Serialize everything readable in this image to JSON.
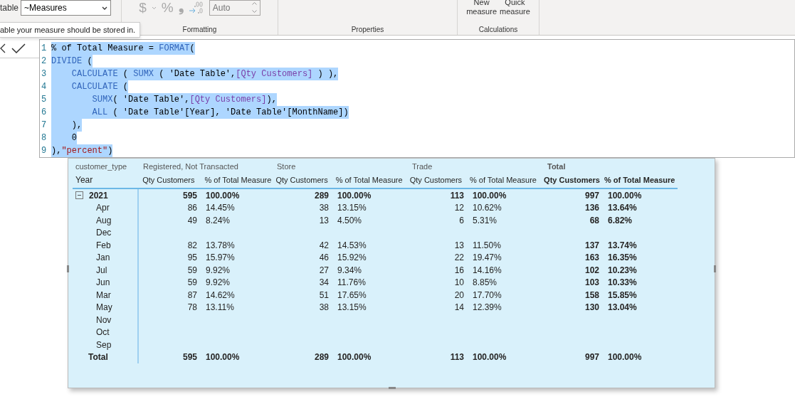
{
  "ribbon": {
    "table_label": "table",
    "table_dropdown": "~Measures",
    "tooltip": "able your measure should be stored in.",
    "currency_symbol": "$",
    "percent_symbol": "%",
    "comma_symbol": "❟",
    "decimal_field": {
      "placeholder": "Auto",
      "disabled": true
    },
    "groups": [
      "Formatting",
      "Properties",
      "Calculations"
    ],
    "buttons": [
      {
        "line1": "New",
        "line2": "measure"
      },
      {
        "line1": "Quick",
        "line2": "measure"
      }
    ]
  },
  "editor": {
    "lines": [
      {
        "number": "1",
        "tokens": [
          {
            "kind": "plain",
            "text": "% of Total Measure = "
          },
          {
            "kind": "fn",
            "text": "FORMAT"
          },
          {
            "kind": "plain",
            "text": "("
          }
        ]
      },
      {
        "number": "2",
        "tokens": [
          {
            "kind": "fn",
            "text": "DIVIDE"
          },
          {
            "kind": "plain",
            "text": " ("
          }
        ]
      },
      {
        "number": "3",
        "tokens": [
          {
            "kind": "fn",
            "text": "    CALCULATE"
          },
          {
            "kind": "plain",
            "text": " ( "
          },
          {
            "kind": "fn",
            "text": "SUMX"
          },
          {
            "kind": "plain",
            "text": " ( 'Date Table',"
          },
          {
            "kind": "measure",
            "text": "[Qty Customers]"
          },
          {
            "kind": "plain",
            "text": " ) ),"
          }
        ]
      },
      {
        "number": "4",
        "tokens": [
          {
            "kind": "fn",
            "text": "    CALCULATE"
          },
          {
            "kind": "plain",
            "text": " ("
          }
        ]
      },
      {
        "number": "5",
        "tokens": [
          {
            "kind": "fn",
            "text": "        SUMX"
          },
          {
            "kind": "plain",
            "text": "( 'Date Table',"
          },
          {
            "kind": "measure",
            "text": "[Qty Customers]"
          },
          {
            "kind": "plain",
            "text": "),"
          }
        ]
      },
      {
        "number": "6",
        "tokens": [
          {
            "kind": "fn",
            "text": "        ALL"
          },
          {
            "kind": "plain",
            "text": " ( 'Date Table'[Year], 'Date Table'[MonthName])"
          }
        ]
      },
      {
        "number": "7",
        "tokens": [
          {
            "kind": "plain",
            "text": "    ),"
          }
        ]
      },
      {
        "number": "8",
        "tokens": [
          {
            "kind": "plain",
            "text": "    0"
          }
        ]
      },
      {
        "number": "9",
        "tokens": [
          {
            "kind": "plain",
            "text": "),"
          },
          {
            "kind": "string",
            "text": "\"percent\""
          },
          {
            "kind": "plain",
            "text": ")"
          }
        ]
      }
    ]
  },
  "matrix": {
    "group_header": "customer_type",
    "groups": [
      "Registered, Not Transacted",
      "Store",
      "Trade",
      "Total"
    ],
    "row_header": "Year",
    "columns": [
      "Qty Customers",
      "% of Total Measure",
      "Qty Customers",
      "% of Total Measure",
      "Qty Customers",
      "% of Total Measure",
      "Qty Customers",
      "% of Total Measure"
    ],
    "rows": [
      {
        "kind": "year",
        "label": "2021",
        "expanded": true,
        "cells": [
          "595",
          "100.00%",
          "289",
          "100.00%",
          "113",
          "100.00%",
          "997",
          "100.00%"
        ]
      },
      {
        "kind": "month",
        "label": "Apr",
        "cells": [
          "86",
          "14.45%",
          "38",
          "13.15%",
          "12",
          "10.62%",
          "136",
          "13.64%"
        ]
      },
      {
        "kind": "month",
        "label": "Aug",
        "cells": [
          "49",
          "8.24%",
          "13",
          "4.50%",
          "6",
          "5.31%",
          "68",
          "6.82%"
        ]
      },
      {
        "kind": "month",
        "label": "Dec"
      },
      {
        "kind": "month",
        "label": "Feb",
        "cells": [
          "82",
          "13.78%",
          "42",
          "14.53%",
          "13",
          "11.50%",
          "137",
          "13.74%"
        ]
      },
      {
        "kind": "month",
        "label": "Jan",
        "cells": [
          "95",
          "15.97%",
          "46",
          "15.92%",
          "22",
          "19.47%",
          "163",
          "16.35%"
        ]
      },
      {
        "kind": "month",
        "label": "Jul",
        "cells": [
          "59",
          "9.92%",
          "27",
          "9.34%",
          "16",
          "14.16%",
          "102",
          "10.23%"
        ]
      },
      {
        "kind": "month",
        "label": "Jun",
        "cells": [
          "59",
          "9.92%",
          "34",
          "11.76%",
          "10",
          "8.85%",
          "103",
          "10.33%"
        ]
      },
      {
        "kind": "month",
        "label": "Mar",
        "cells": [
          "87",
          "14.62%",
          "51",
          "17.65%",
          "20",
          "17.70%",
          "158",
          "15.85%"
        ]
      },
      {
        "kind": "month",
        "label": "May",
        "cells": [
          "78",
          "13.11%",
          "38",
          "13.15%",
          "14",
          "12.39%",
          "130",
          "13.04%"
        ]
      },
      {
        "kind": "month",
        "label": "Nov"
      },
      {
        "kind": "month",
        "label": "Oct"
      },
      {
        "kind": "month",
        "label": "Sep"
      },
      {
        "kind": "total",
        "label": "Total",
        "cells": [
          "595",
          "100.00%",
          "289",
          "100.00%",
          "113",
          "100.00%",
          "997",
          "100.00%"
        ]
      }
    ]
  }
}
